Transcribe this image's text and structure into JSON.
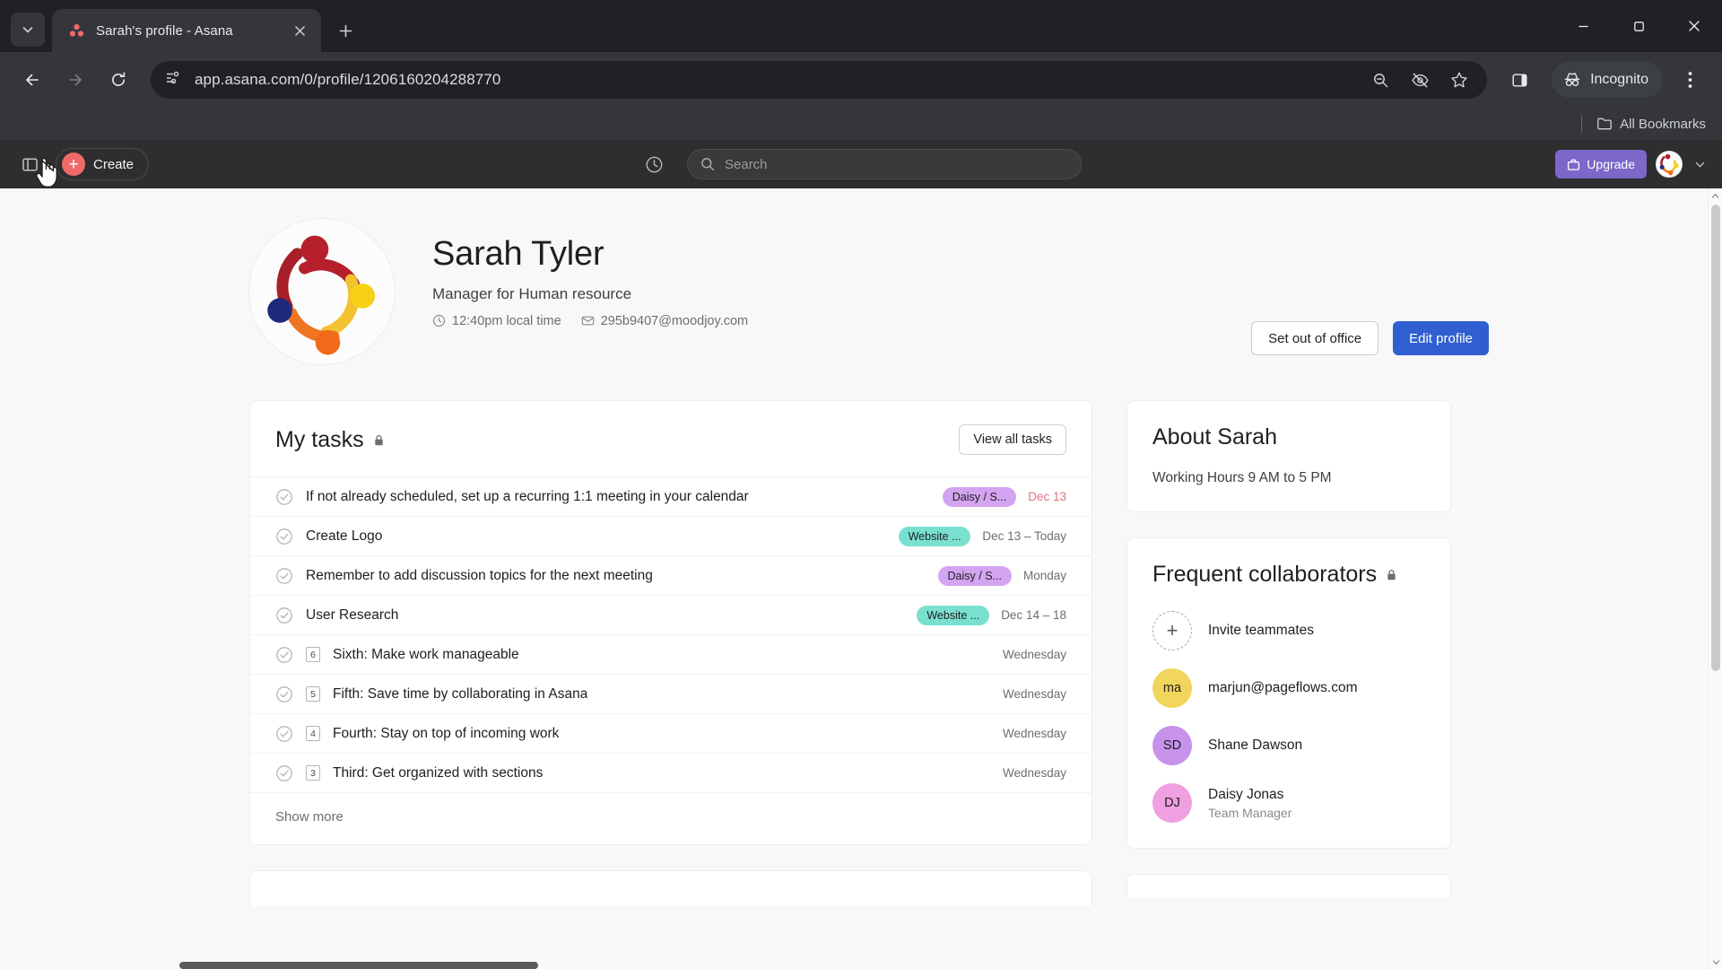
{
  "browser": {
    "tab": {
      "title": "Sarah's profile - Asana",
      "favicon": "asana-icon"
    },
    "url": "app.asana.com/0/profile/1206160204288770",
    "incognito_label": "Incognito",
    "bookmarks_label": "All Bookmarks",
    "icons": {
      "tab_search": "chevron-down-icon",
      "new_tab": "plus-icon",
      "close_tab": "close-icon",
      "back": "back-arrow-icon",
      "forward": "forward-arrow-icon",
      "reload": "reload-icon",
      "site_info": "page-info-icon",
      "zoom": "zoom-out-icon",
      "tracking": "eye-off-icon",
      "bookmark": "star-icon",
      "side_panel": "side-panel-icon",
      "menu": "three-dots-icon",
      "minimize": "minimize-icon",
      "maximize": "maximize-icon",
      "window_close": "close-icon"
    }
  },
  "topbar": {
    "create_label": "Create",
    "search_placeholder": "Search",
    "search_value": "",
    "upgrade_label": "Upgrade",
    "icons": {
      "sidebar": "sidebar-toggle-icon",
      "history": "clock-history-icon",
      "search": "search-icon",
      "upgrade": "briefcase-icon",
      "caret": "chevron-down-icon"
    }
  },
  "profile": {
    "name": "Sarah Tyler",
    "role": "Manager for Human resource",
    "local_time": "12:40pm local time",
    "email": "295b9407@moodjoy.com",
    "set_out_of_office_label": "Set out of office",
    "edit_profile_label": "Edit profile"
  },
  "my_tasks": {
    "title": "My tasks",
    "view_all_label": "View all tasks",
    "show_more_label": "Show more",
    "tasks": [
      {
        "name": "If not already scheduled, set up a recurring 1:1 meeting in your calendar",
        "badge": "",
        "project": "Daisy / S...",
        "project_color": "#d3a4f0",
        "due": "Dec 13",
        "overdue": true
      },
      {
        "name": "Create Logo",
        "badge": "",
        "project": "Website ...",
        "project_color": "#79e0d0",
        "due": "Dec 13 – Today",
        "overdue": false
      },
      {
        "name": "Remember to add discussion topics for the next meeting",
        "badge": "",
        "project": "Daisy / S...",
        "project_color": "#d3a4f0",
        "due": "Monday",
        "overdue": false
      },
      {
        "name": "User Research",
        "badge": "",
        "project": "Website ...",
        "project_color": "#79e0d0",
        "due": "Dec 14 – 18",
        "overdue": false
      },
      {
        "name": "Sixth: Make work manageable",
        "badge": "6",
        "project": "",
        "project_color": "",
        "due": "Wednesday",
        "overdue": false
      },
      {
        "name": "Fifth: Save time by collaborating in Asana",
        "badge": "5",
        "project": "",
        "project_color": "",
        "due": "Wednesday",
        "overdue": false
      },
      {
        "name": "Fourth: Stay on top of incoming work",
        "badge": "4",
        "project": "",
        "project_color": "",
        "due": "Wednesday",
        "overdue": false
      },
      {
        "name": "Third: Get organized with sections",
        "badge": "3",
        "project": "",
        "project_color": "",
        "due": "Wednesday",
        "overdue": false
      }
    ]
  },
  "about": {
    "title": "About Sarah",
    "working_hours": "Working Hours 9 AM to 5 PM"
  },
  "collaborators": {
    "title": "Frequent collaborators",
    "invite_label": "Invite teammates",
    "people": [
      {
        "initials": "ma",
        "name": "marjun@pageflows.com",
        "subtitle": "",
        "color": "#f2d55c"
      },
      {
        "initials": "SD",
        "name": "Shane Dawson",
        "subtitle": "",
        "color": "#c692ea"
      },
      {
        "initials": "DJ",
        "name": "Daisy Jonas",
        "subtitle": "Team Manager",
        "color": "#f09fe0"
      }
    ]
  },
  "colors": {
    "accent_blue": "#2f5fd0",
    "asana_coral": "#f06a6a",
    "upgrade_purple": "#7b68c8",
    "overdue_red": "#e0737e"
  }
}
